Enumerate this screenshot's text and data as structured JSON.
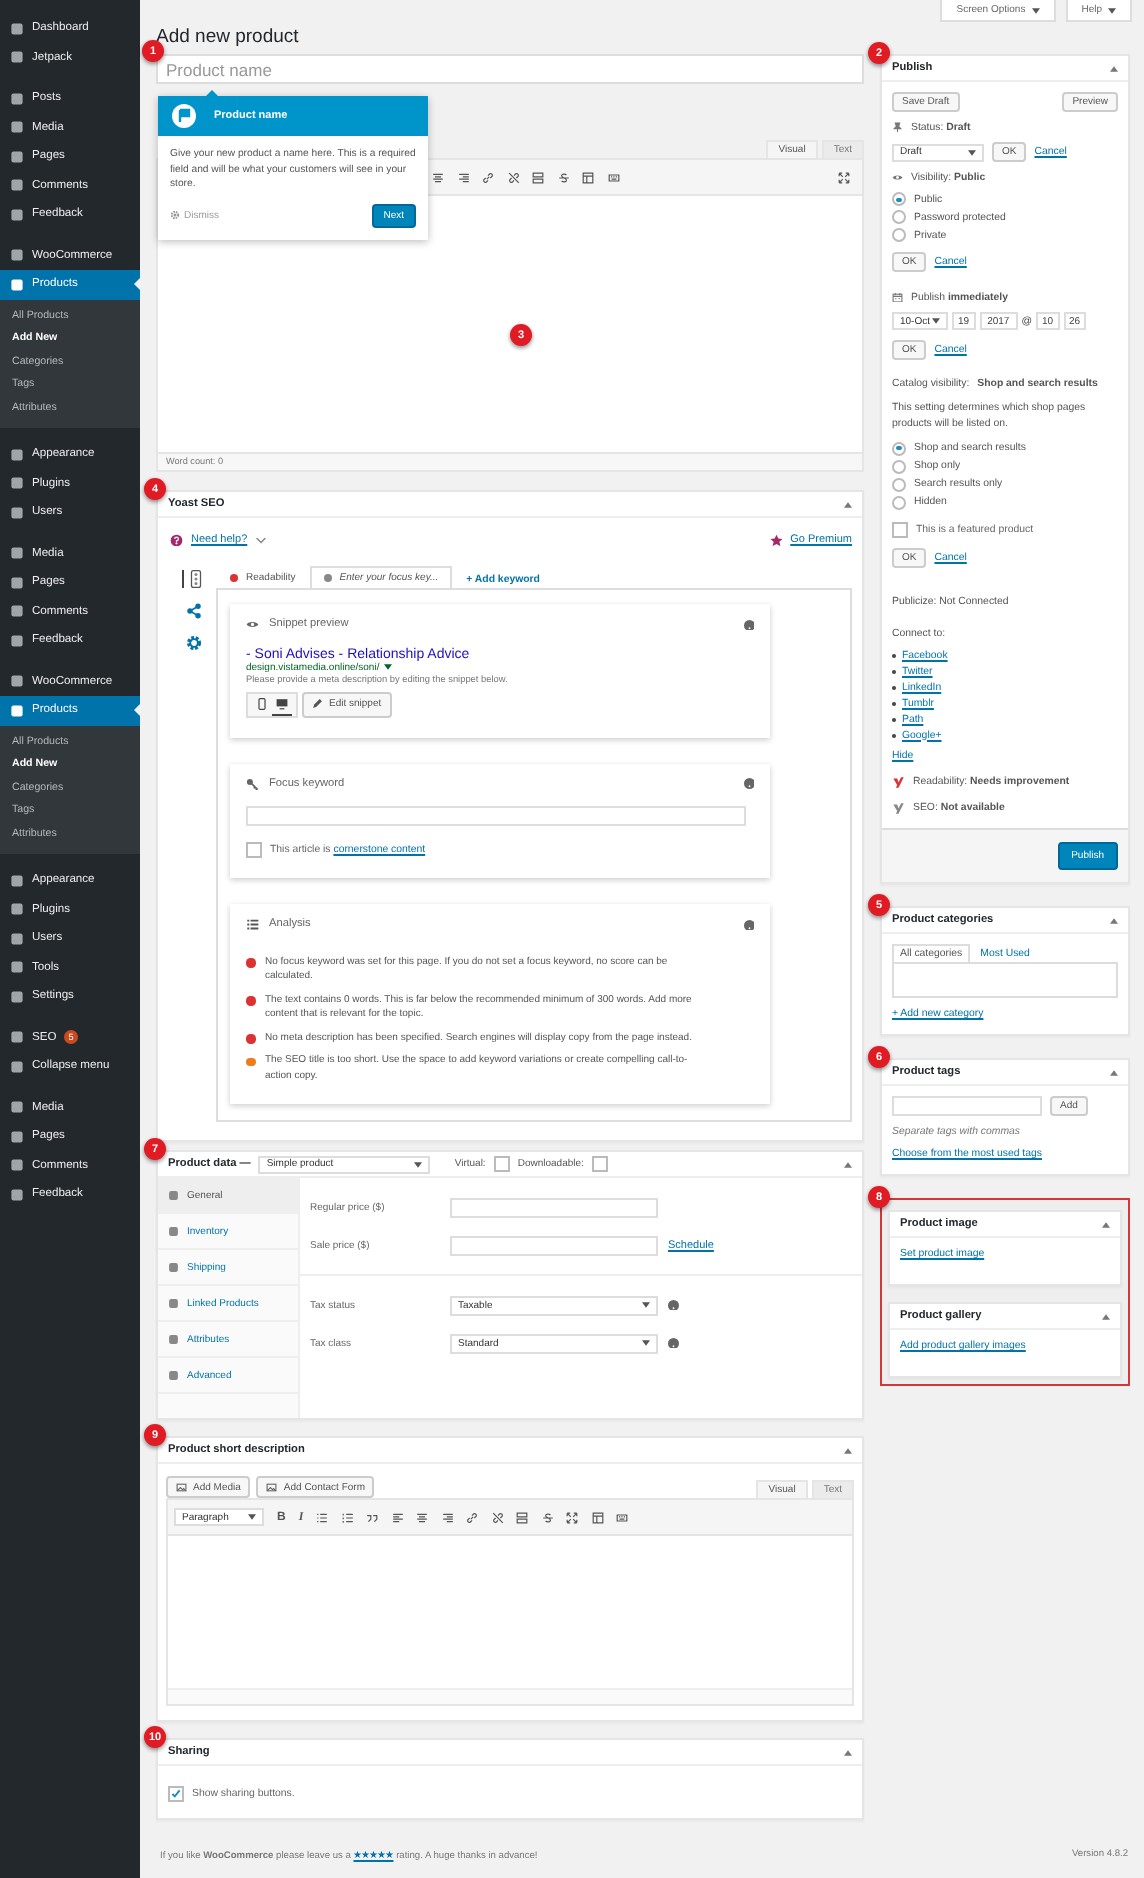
{
  "sidebar": {
    "groups": [
      [
        {
          "label": "Dashboard",
          "selected": false
        },
        {
          "label": "Jetpack",
          "selected": false
        }
      ],
      [
        {
          "label": "Posts",
          "selected": false
        },
        {
          "label": "Media",
          "selected": false
        },
        {
          "label": "Pages",
          "selected": false
        },
        {
          "label": "Comments",
          "selected": false
        },
        {
          "label": "Feedback",
          "selected": false
        }
      ],
      [
        {
          "label": "WooCommerce",
          "selected": false
        },
        {
          "label": "Products",
          "selected": true,
          "children": [
            {
              "label": "All Products",
              "selected": false
            },
            {
              "label": "Add New",
              "selected": true
            },
            {
              "label": "Categories",
              "selected": false
            },
            {
              "label": "Tags",
              "selected": false
            },
            {
              "label": "Attributes",
              "selected": false
            }
          ]
        }
      ],
      [
        {
          "label": "Appearance",
          "selected": false
        },
        {
          "label": "Plugins",
          "selected": false
        },
        {
          "label": "Users",
          "selected": false
        }
      ],
      [
        {
          "label": "Media",
          "selected": false
        },
        {
          "label": "Pages",
          "selected": false
        },
        {
          "label": "Comments",
          "selected": false
        },
        {
          "label": "Feedback",
          "selected": false
        }
      ],
      [
        {
          "label": "WooCommerce",
          "selected": false
        },
        {
          "label": "Products",
          "selected": true,
          "children": [
            {
              "label": "All Products",
              "selected": false
            },
            {
              "label": "Add New",
              "selected": true
            },
            {
              "label": "Categories",
              "selected": false
            },
            {
              "label": "Tags",
              "selected": false
            },
            {
              "label": "Attributes",
              "selected": false
            }
          ]
        }
      ],
      [
        {
          "label": "Appearance",
          "selected": false
        },
        {
          "label": "Plugins",
          "selected": false
        },
        {
          "label": "Users",
          "selected": false
        },
        {
          "label": "Tools",
          "selected": false
        },
        {
          "label": "Settings",
          "selected": false
        }
      ],
      [
        {
          "label": "SEO",
          "selected": false,
          "badge": "5"
        },
        {
          "label": "Collapse menu",
          "selected": false
        }
      ],
      [
        {
          "label": "Media",
          "selected": false
        },
        {
          "label": "Pages",
          "selected": false
        },
        {
          "label": "Comments",
          "selected": false
        },
        {
          "label": "Feedback",
          "selected": false
        }
      ]
    ]
  },
  "top_buttons": [
    "Screen Options",
    "Help"
  ],
  "page_title": "Add new product",
  "product_name": {
    "placeholder": "Product name",
    "marker": "1"
  },
  "tooltip": {
    "title": "Product name",
    "body": "Give your new product a name here. This is a required field and will be what your customers will see in your store.",
    "dismiss": "Dismiss",
    "next": "Next"
  },
  "editor": {
    "marker": "3",
    "tabs": [
      {
        "label": "Visual",
        "selected": true
      },
      {
        "label": "Text",
        "selected": false
      }
    ],
    "word_count": "Word count: 0"
  },
  "yoast": {
    "title": "Yoast SEO",
    "marker": "4",
    "help": "Need help?",
    "premium": "Go Premium",
    "tabs": [
      {
        "label": "Readability",
        "selected": false,
        "color": "#dc3232"
      },
      {
        "label": "Enter your focus key...",
        "selected": true,
        "color": "#888888"
      }
    ],
    "add_keyword": "+ Add keyword",
    "snippet": {
      "title": "Snippet preview",
      "seo_title": "- Soni Advises - Relationship Advice",
      "url": "design.vistamedia.online/soni/",
      "description": "Please provide a meta description by editing the snippet below.",
      "modes": [
        {
          "kind": "mobile",
          "selected": false
        },
        {
          "kind": "desktop",
          "selected": true
        }
      ],
      "edit": "Edit snippet"
    },
    "focus": {
      "title": "Focus keyword",
      "cornerstone": "This article is ",
      "cornerstone_link": "cornerstone content",
      "checked": false
    },
    "analysis": {
      "title": "Analysis",
      "items": [
        {
          "text": "No focus keyword was set for this page. If you do not set a focus keyword, no score can be calculated.",
          "color": "#dc3232"
        },
        {
          "text": "The text contains 0 words. This is far below the recommended minimum of 300 words. Add more content that is relevant for the topic.",
          "color": "#dc3232"
        },
        {
          "text": "No meta description has been specified. Search engines will display copy from the page instead.",
          "color": "#dc3232"
        },
        {
          "text": "The SEO title is too short. Use the space to add keyword variations or create compelling call-to-action copy.",
          "color": "#ee7c1b"
        }
      ]
    }
  },
  "product_data": {
    "title": "Product data —",
    "marker": "7",
    "type": "Simple product",
    "virtual": {
      "label": "Virtual:",
      "checked": false
    },
    "downloadable": {
      "label": "Downloadable:",
      "checked": false
    },
    "tabs": [
      {
        "label": "General",
        "selected": true
      },
      {
        "label": "Inventory",
        "selected": false
      },
      {
        "label": "Shipping",
        "selected": false
      },
      {
        "label": "Linked Products",
        "selected": false
      },
      {
        "label": "Attributes",
        "selected": false
      },
      {
        "label": "Advanced",
        "selected": false
      }
    ],
    "groups": [
      [
        {
          "kind": "input",
          "label": "Regular price ($)"
        },
        {
          "kind": "input",
          "label": "Sale price ($)",
          "link": "Schedule"
        }
      ],
      [
        {
          "kind": "select",
          "label": "Tax status",
          "value": "Taxable"
        },
        {
          "kind": "select",
          "label": "Tax class",
          "value": "Standard"
        }
      ]
    ]
  },
  "short_description": {
    "title": "Product short description",
    "marker": "9",
    "media_buttons": [
      "Add Media",
      "Add Contact Form"
    ],
    "tabs": [
      {
        "label": "Visual",
        "selected": true
      },
      {
        "label": "Text",
        "selected": false
      }
    ],
    "format": "Paragraph",
    "format_buttons": [
      "B",
      "I"
    ]
  },
  "sharing": {
    "title": "Sharing",
    "marker": "10",
    "option": {
      "label": "Show sharing buttons.",
      "checked": true
    }
  },
  "footer": {
    "before": "If you like **WooCommerce** please leave us a ",
    "link": "★★★★★",
    "after": " rating. A huge thanks in advance!",
    "version": "Version 4.8.2"
  },
  "publish": {
    "title": "Publish",
    "marker": "2",
    "save_draft": "Save Draft",
    "preview": "Preview",
    "status": {
      "text": "Status: **Draft**",
      "select": "Draft",
      "ok": "OK",
      "cancel": "Cancel"
    },
    "visibility": {
      "text": "Visibility: **Public**",
      "options": [
        {
          "label": "Public",
          "selected": true
        },
        {
          "label": "Password protected",
          "selected": false
        },
        {
          "label": "Private",
          "selected": false
        }
      ],
      "ok": "OK",
      "cancel": "Cancel"
    },
    "schedule": {
      "text": "Publish **immediately**",
      "month": "10-Oct",
      "day": "19",
      "year": "2017",
      "at": "@",
      "hour": "10",
      "minute": "26",
      "ok": "OK",
      "cancel": "Cancel"
    },
    "catalog": {
      "text": "Catalog visibility: **Shop and search results**",
      "note": "This setting determines which shop pages products will be listed on.",
      "options": [
        {
          "label": "Shop and search results",
          "selected": true
        },
        {
          "label": "Shop only",
          "selected": false
        },
        {
          "label": "Search results only",
          "selected": false
        },
        {
          "label": "Hidden",
          "selected": false
        }
      ],
      "featured": {
        "label": "This is a featured product",
        "checked": false
      },
      "ok": "OK",
      "cancel": "Cancel"
    },
    "publicize": "Publicize: Not Connected",
    "connect": "Connect to:",
    "services": [
      "Facebook",
      "Twitter",
      "LinkedIn",
      "Tumblr",
      "Path",
      "Google+"
    ],
    "hide": "Hide",
    "scores": [
      {
        "text": "Readability: **Needs improvement**",
        "color": "#dc3232"
      },
      {
        "text": "SEO: **Not available**",
        "color": "#888888"
      }
    ],
    "button": "Publish"
  },
  "categories": {
    "title": "Product categories",
    "marker": "5",
    "tabs": [
      {
        "label": "All categories",
        "selected": true
      },
      {
        "label": "Most Used",
        "selected": false
      }
    ],
    "add": "+ Add new category"
  },
  "tags": {
    "title": "Product tags",
    "marker": "6",
    "add": "Add",
    "hint": "Separate tags with commas",
    "choose": "Choose from the most used tags"
  },
  "images": {
    "marker": "8",
    "highlighted": true,
    "boxes": [
      {
        "title": "Product image",
        "link": "Set product image"
      },
      {
        "title": "Product gallery",
        "link": "Add product gallery images"
      }
    ]
  }
}
